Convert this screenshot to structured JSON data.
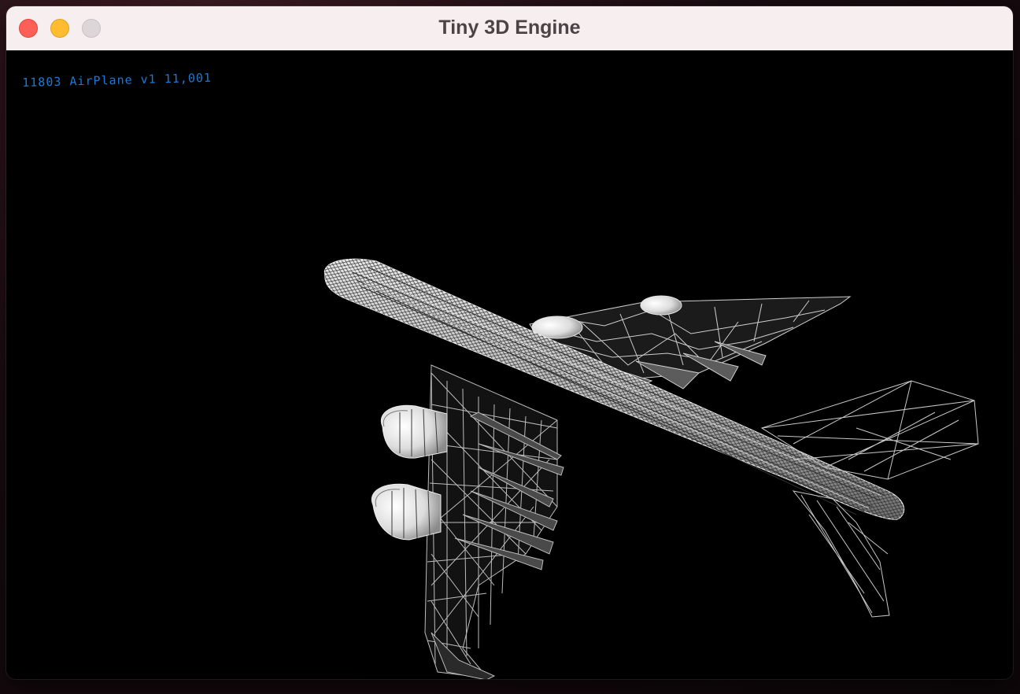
{
  "window": {
    "title": "Tiny 3D Engine",
    "buttons": {
      "close": "close",
      "minimize": "minimize",
      "maximize": "maximize"
    }
  },
  "viewport": {
    "hud_text": "11803 AirPlane v1 11,001",
    "model": "airplane wireframe",
    "background_color": "#000000",
    "hud_color": "#1f79d4"
  }
}
